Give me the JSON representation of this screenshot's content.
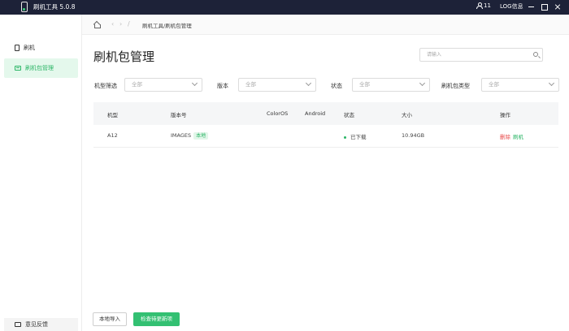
{
  "app": {
    "title": "刷机工具 5.0.8"
  },
  "topbar": {
    "user_count": "11",
    "log_label": "LOG信息"
  },
  "sidebar": {
    "items": [
      {
        "label": "刷机",
        "icon": "phone-icon",
        "active": false
      },
      {
        "label": "刷机包管理",
        "icon": "package-icon",
        "active": true
      }
    ],
    "feedback_label": "意见反馈"
  },
  "breadcrumb": {
    "path": "刷机工具/刷机包管理"
  },
  "page": {
    "title": "刷机包管理"
  },
  "search": {
    "placeholder": "请输入"
  },
  "filters": [
    {
      "label": "机型筛选",
      "value": "全部"
    },
    {
      "label": "版本",
      "value": "全部"
    },
    {
      "label": "状态",
      "value": "全部"
    },
    {
      "label": "刷机包类型",
      "value": "全部"
    }
  ],
  "table": {
    "columns": [
      "机型",
      "版本号",
      "ColorOS",
      "Android",
      "状态",
      "大小",
      "操作"
    ],
    "rows": [
      {
        "model": "A12",
        "version": "IMAGES",
        "version_tag": "本地",
        "coloros": "",
        "android": "",
        "status": "已下载",
        "size": "10.94GB",
        "actions": {
          "delete": "删除",
          "flash": "刷机"
        }
      }
    ]
  },
  "buttons": {
    "import": "本地导入",
    "check_update": "检查待更新项"
  },
  "colors": {
    "topbar": "#1d2238",
    "accent": "#2bb566",
    "danger": "#e84a4a"
  }
}
